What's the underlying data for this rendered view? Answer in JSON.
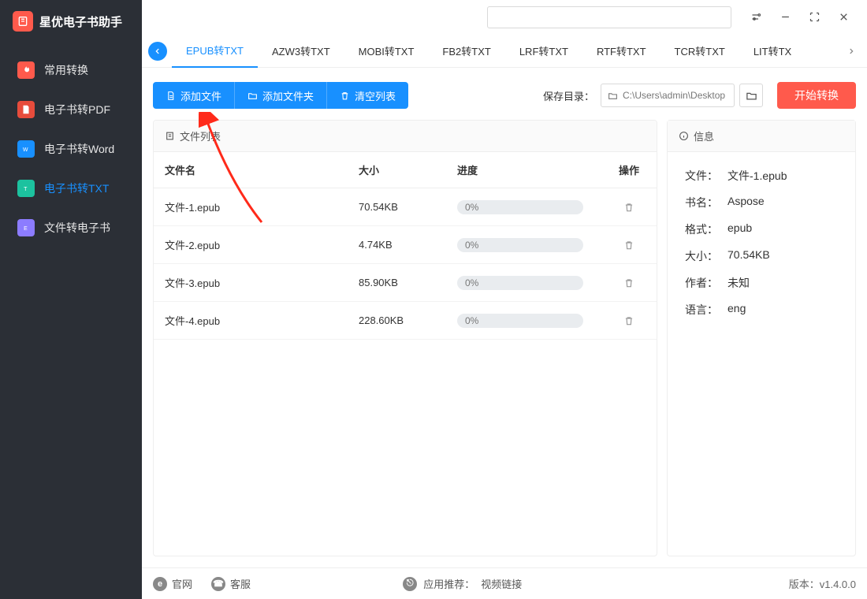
{
  "app_title": "星优电子书助手",
  "sidebar": {
    "items": [
      {
        "label": "常用转换"
      },
      {
        "label": "电子书转PDF"
      },
      {
        "label": "电子书转Word"
      },
      {
        "label": "电子书转TXT"
      },
      {
        "label": "文件转电子书"
      }
    ]
  },
  "tabs": [
    "EPUB转TXT",
    "AZW3转TXT",
    "MOBI转TXT",
    "FB2转TXT",
    "LRF转TXT",
    "RTF转TXT",
    "TCR转TXT",
    "LIT转TX"
  ],
  "toolbar": {
    "add_file": "添加文件",
    "add_folder": "添加文件夹",
    "clear_list": "清空列表",
    "save_label": "保存目录：",
    "save_path": "C:\\Users\\admin\\Desktop",
    "start": "开始转换"
  },
  "list": {
    "title": "文件列表",
    "columns": {
      "name": "文件名",
      "size": "大小",
      "progress": "进度",
      "action": "操作"
    },
    "rows": [
      {
        "name": "文件-1.epub",
        "size": "70.54KB",
        "progress": "0%"
      },
      {
        "name": "文件-2.epub",
        "size": "4.74KB",
        "progress": "0%"
      },
      {
        "name": "文件-3.epub",
        "size": "85.90KB",
        "progress": "0%"
      },
      {
        "name": "文件-4.epub",
        "size": "228.60KB",
        "progress": "0%"
      }
    ]
  },
  "info": {
    "title": "信息",
    "rows": [
      {
        "k": "文件",
        "v": "文件-1.epub"
      },
      {
        "k": "书名",
        "v": "Aspose"
      },
      {
        "k": "格式",
        "v": "epub"
      },
      {
        "k": "大小",
        "v": "70.54KB"
      },
      {
        "k": "作者",
        "v": "未知"
      },
      {
        "k": "语言",
        "v": "eng"
      }
    ]
  },
  "footer": {
    "site": "官网",
    "support": "客服",
    "recommend_label": "应用推荐：",
    "recommend_link": "视频链接",
    "version_label": "版本：",
    "version": "v1.4.0.0"
  }
}
